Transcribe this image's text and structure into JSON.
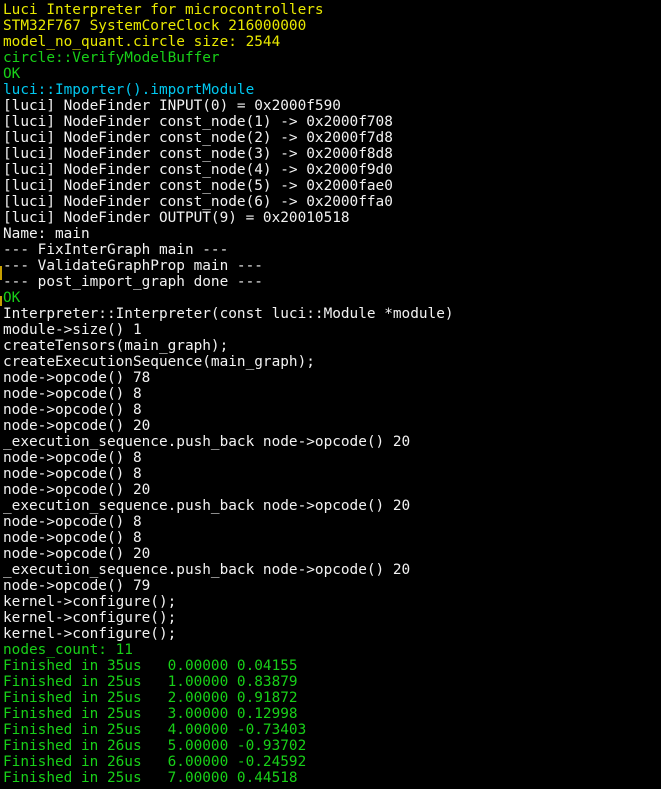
{
  "terminal": {
    "background": "#000000",
    "colors": {
      "yellow": "#e8e800",
      "cyan": "#00c8f0",
      "white": "#f2f2f2",
      "green": "#18d018"
    },
    "lines": [
      {
        "text": "Luci Interpreter for microcontrollers",
        "color": "yellow"
      },
      {
        "text": "STM32F767 SystemCoreClock 216000000",
        "color": "yellow"
      },
      {
        "text": "model_no_quant.circle size: 2544",
        "color": "yellow"
      },
      {
        "text": "circle::VerifyModelBuffer",
        "color": "green"
      },
      {
        "text": "OK",
        "color": "green"
      },
      {
        "text": "luci::Importer().importModule",
        "color": "cyan"
      },
      {
        "text": "[luci] NodeFinder INPUT(0) = 0x2000f590",
        "color": "white"
      },
      {
        "text": "[luci] NodeFinder const_node(1) -> 0x2000f708",
        "color": "white"
      },
      {
        "text": "[luci] NodeFinder const_node(2) -> 0x2000f7d8",
        "color": "white"
      },
      {
        "text": "[luci] NodeFinder const_node(3) -> 0x2000f8d8",
        "color": "white"
      },
      {
        "text": "[luci] NodeFinder const_node(4) -> 0x2000f9d0",
        "color": "white"
      },
      {
        "text": "[luci] NodeFinder const_node(5) -> 0x2000fae0",
        "color": "white"
      },
      {
        "text": "[luci] NodeFinder const_node(6) -> 0x2000ffa0",
        "color": "white"
      },
      {
        "text": "[luci] NodeFinder OUTPUT(9) = 0x20010518",
        "color": "white"
      },
      {
        "text": "Name: main",
        "color": "white"
      },
      {
        "text": "--- FixInterGraph main ---",
        "color": "white"
      },
      {
        "text": "--- ValidateGraphProp main ---",
        "color": "white"
      },
      {
        "text": "--- post_import_graph done ---",
        "color": "white"
      },
      {
        "text": "OK",
        "color": "green"
      },
      {
        "text": "Interpreter::Interpreter(const luci::Module *module)",
        "color": "white"
      },
      {
        "text": "module->size() 1",
        "color": "white"
      },
      {
        "text": "createTensors(main_graph);",
        "color": "white"
      },
      {
        "text": "createExecutionSequence(main_graph);",
        "color": "white"
      },
      {
        "text": "node->opcode() 78",
        "color": "white"
      },
      {
        "text": "node->opcode() 8",
        "color": "white"
      },
      {
        "text": "node->opcode() 8",
        "color": "white"
      },
      {
        "text": "node->opcode() 20",
        "color": "white"
      },
      {
        "text": "_execution_sequence.push_back node->opcode() 20",
        "color": "white"
      },
      {
        "text": "node->opcode() 8",
        "color": "white"
      },
      {
        "text": "node->opcode() 8",
        "color": "white"
      },
      {
        "text": "node->opcode() 20",
        "color": "white"
      },
      {
        "text": "_execution_sequence.push_back node->opcode() 20",
        "color": "white"
      },
      {
        "text": "node->opcode() 8",
        "color": "white"
      },
      {
        "text": "node->opcode() 8",
        "color": "white"
      },
      {
        "text": "node->opcode() 20",
        "color": "white"
      },
      {
        "text": "_execution_sequence.push_back node->opcode() 20",
        "color": "white"
      },
      {
        "text": "node->opcode() 79",
        "color": "white"
      },
      {
        "text": "kernel->configure();",
        "color": "white"
      },
      {
        "text": "kernel->configure();",
        "color": "white"
      },
      {
        "text": "kernel->configure();",
        "color": "white"
      },
      {
        "text": "nodes_count: 11",
        "color": "green"
      },
      {
        "text": "Finished in 35us   0.00000 0.04155",
        "color": "green"
      },
      {
        "text": "Finished in 25us   1.00000 0.83879",
        "color": "green"
      },
      {
        "text": "Finished in 25us   2.00000 0.91872",
        "color": "green"
      },
      {
        "text": "Finished in 25us   3.00000 0.12998",
        "color": "green"
      },
      {
        "text": "Finished in 25us   4.00000 -0.73403",
        "color": "green"
      },
      {
        "text": "Finished in 26us   5.00000 -0.93702",
        "color": "green"
      },
      {
        "text": "Finished in 26us   6.00000 -0.24592",
        "color": "green"
      },
      {
        "text": "Finished in 25us   7.00000 0.44518",
        "color": "green"
      }
    ]
  }
}
